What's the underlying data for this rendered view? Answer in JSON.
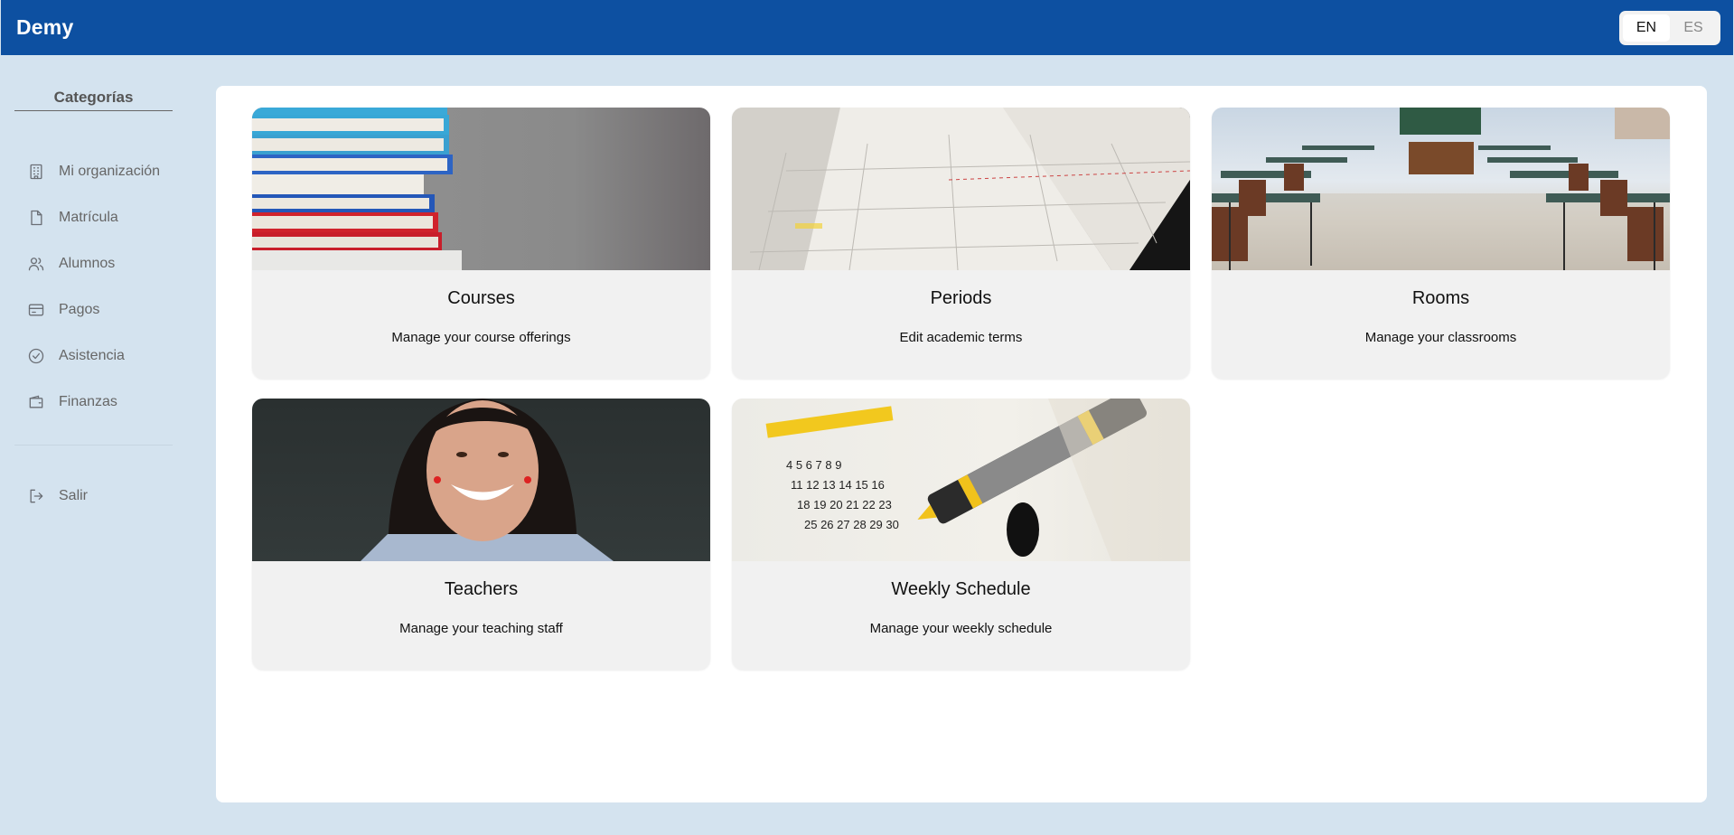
{
  "app": {
    "brand": "Demy"
  },
  "language": {
    "options": [
      "EN",
      "ES"
    ],
    "selected": "EN"
  },
  "sidebar": {
    "title": "Categorías",
    "items": [
      {
        "label": "Mi organización",
        "icon": "building-icon"
      },
      {
        "label": "Matrícula",
        "icon": "document-icon"
      },
      {
        "label": "Alumnos",
        "icon": "users-icon"
      },
      {
        "label": "Pagos",
        "icon": "credit-card-icon"
      },
      {
        "label": "Asistencia",
        "icon": "check-circle-icon"
      },
      {
        "label": "Finanzas",
        "icon": "wallet-icon"
      }
    ],
    "logout": {
      "label": "Salir",
      "icon": "logout-icon"
    }
  },
  "cards": [
    {
      "title": "Courses",
      "description": "Manage your course offerings",
      "image": "stack-of-books"
    },
    {
      "title": "Periods",
      "description": "Edit academic terms",
      "image": "open-planner"
    },
    {
      "title": "Rooms",
      "description": "Manage your classrooms",
      "image": "empty-classroom"
    },
    {
      "title": "Teachers",
      "description": "Manage your teaching staff",
      "image": "smiling-teacher"
    },
    {
      "title": "Weekly Schedule",
      "description": "Manage your weekly schedule",
      "image": "calendar-with-marker"
    }
  ],
  "colors": {
    "header": "#0d50a1",
    "background": "#d4e3ef",
    "card": "#f1f1f1"
  }
}
